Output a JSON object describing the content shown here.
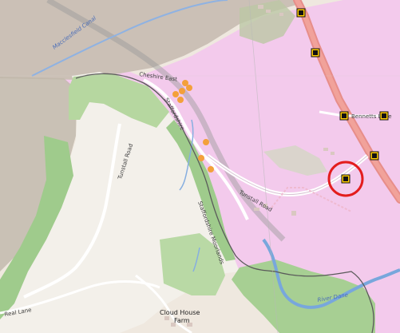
{
  "map": {
    "road_labels": {
      "tunstall_road_west": "Tunstall Road",
      "tunstall_road_east": "Tunstall Road",
      "bennetts_lane": "Bennetts Lane",
      "real_lane": "Real Lane"
    },
    "waterway_labels": {
      "macclesfield_canal": "Macclesfield Canal",
      "cheshire_east": "Cheshire East",
      "staffordshire": "Staffordshire",
      "staffordshire_moorlands": "Staffordshire Moorlands",
      "river_dane": "River Dane"
    },
    "places": {
      "cloud_house_farm_line1": "Cloud House",
      "cloud_house_farm_line2": "Farm"
    },
    "icon_names": [
      "speed-camera-icon",
      "orange-poi-dot"
    ],
    "colors": {
      "pink_region": "#f2c8ec",
      "grey_region": "#c9bfb7",
      "land": "#f2efe9",
      "wood": "#add19e",
      "road_main": "#e7938d",
      "water": "#7aa2d6",
      "camera_yellow": "#ffcc00",
      "highlight_red": "#e31d1d"
    }
  }
}
